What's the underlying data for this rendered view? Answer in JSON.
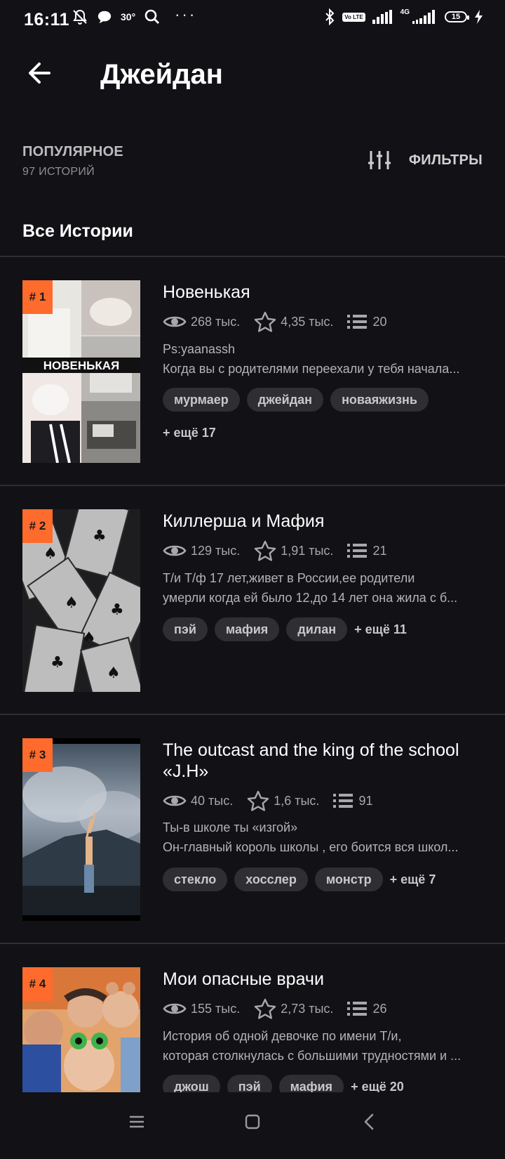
{
  "status_bar": {
    "time": "16:11",
    "temperature": "30°",
    "battery": "15",
    "network": "4G",
    "volte": "Vo LTE"
  },
  "header": {
    "title": "Джейдан"
  },
  "sort": {
    "label": "ПОПУЛЯРНОЕ",
    "count": "97 ИСТОРИЙ"
  },
  "filters": {
    "label": "ФИЛЬТРЫ"
  },
  "section_title": "Все Истории",
  "stories": [
    {
      "rank": "# 1",
      "title": "Новенькая",
      "views": "268 тыс.",
      "votes": "4,35 тыс.",
      "parts": "20",
      "desc1": "Ps:yaanassh",
      "desc2": "Когда вы с родителями переехали у тебя начала...",
      "tags": [
        "мурмаер",
        "джейдан",
        "новаяжизнь"
      ],
      "more": "+ ещё 17",
      "cover_text": "НОВЕНЬКАЯ"
    },
    {
      "rank": "# 2",
      "title": "Киллерша и Мафия",
      "views": "129 тыс.",
      "votes": "1,91 тыс.",
      "parts": "21",
      "desc1": "Т/и Т/ф 17 лет,живет в России,ее родители",
      "desc2": "умерли когда ей было 12,до 14 лет она жила с б...",
      "tags": [
        "пэй",
        "мафия",
        "дилан"
      ],
      "more": "+ ещё 11"
    },
    {
      "rank": "# 3",
      "title": "The outcast and the king of the school «J.H»",
      "views": "40 тыс.",
      "votes": "1,6 тыс.",
      "parts": "91",
      "desc1": "Ты-в школе ты «изгой»",
      "desc2": "Он-главный король школы , его боится вся школ...",
      "tags": [
        "стекло",
        "хосслер",
        "монстр"
      ],
      "more": "+ ещё 7"
    },
    {
      "rank": "# 4",
      "title": "Мои опасные врачи",
      "views": "155 тыс.",
      "votes": "2,73 тыс.",
      "parts": "26",
      "desc1": "История об одной девочке по имени Т/и,",
      "desc2": "которая столкнулась с большими трудностями и ...",
      "tags": [
        "джош",
        "пэй",
        "мафия"
      ],
      "more": "+ ещё 20"
    }
  ]
}
